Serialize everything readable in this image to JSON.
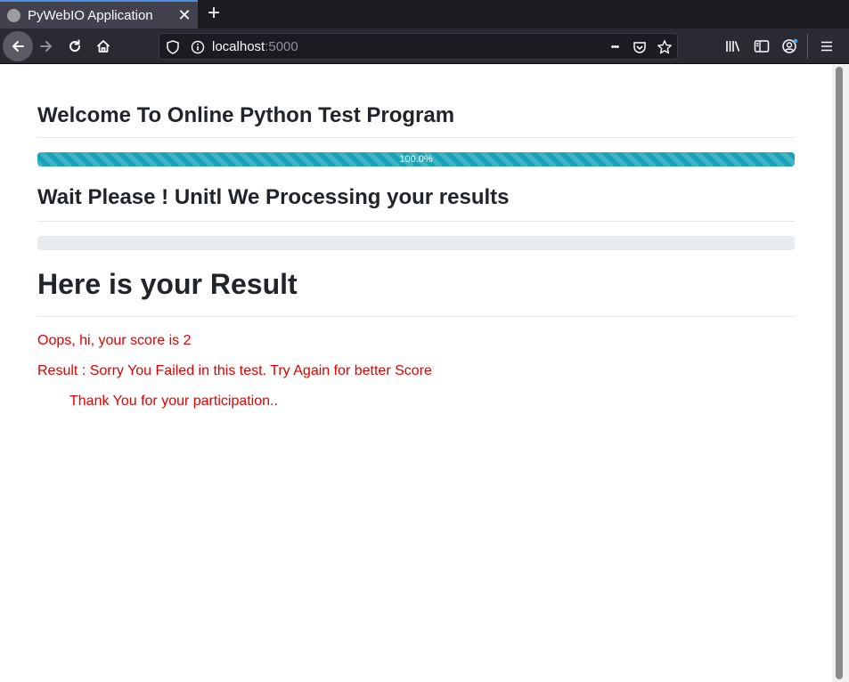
{
  "browser": {
    "tab_title": "PyWebIO Application",
    "new_tab_symbol": "+",
    "close_symbol": "✕",
    "url_host": "localhost",
    "url_port": ":5000",
    "more_symbol": "•••"
  },
  "page": {
    "welcome_title": "Welcome To Online Python Test Program",
    "progress_1": {
      "label": "100.0%",
      "value": 1.0
    },
    "wait_title": "Wait Please ! Unitl We Processing your results",
    "progress_2": {
      "label": "",
      "value": 0.0
    },
    "result_title": "Here is your Result",
    "score_line": "Oops, hi, your score is 2",
    "result_line": "Result : Sorry You Failed in this test. Try Again for better Score",
    "thanks_line": "Thank You for your participation.."
  },
  "colors": {
    "progress": "#17a2b8",
    "wait_title": "#0000ee",
    "message": "#e00000"
  }
}
